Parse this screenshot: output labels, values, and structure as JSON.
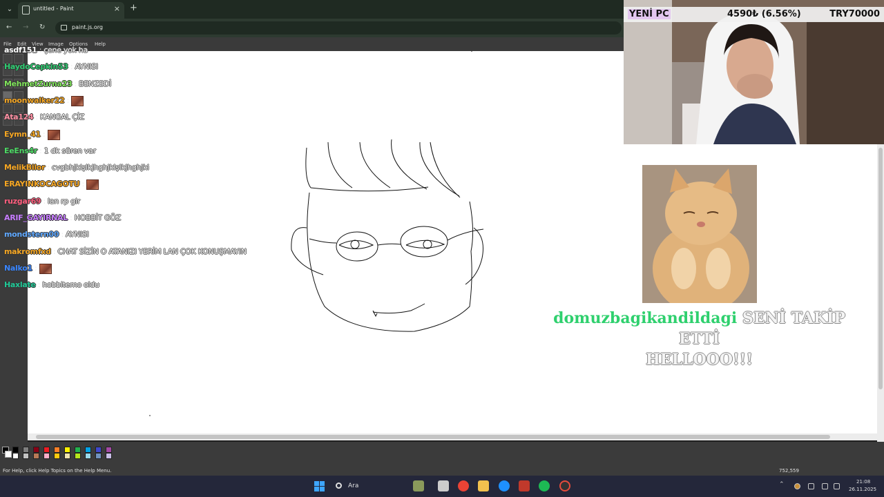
{
  "browser": {
    "tab_title": "untitled - Paint",
    "url": "paint.js.org",
    "close_glyph": "×",
    "new_tab_glyph": "+",
    "back_glyph": "←",
    "forward_glyph": "→",
    "reload_glyph": "↻",
    "tab_menu_glyph": "⌄"
  },
  "paint": {
    "menu": [
      "File",
      "Edit",
      "View",
      "Image",
      "Options",
      "Help"
    ],
    "status_text": "For Help, click Help Topics on the Help Menu.",
    "cursor_coords": "752,559",
    "palette_colors": [
      "#000000",
      "#7f7f7f",
      "#880015",
      "#ed1c24",
      "#ff7f27",
      "#fff200",
      "#22b14c",
      "#00a2e8",
      "#3f48cc",
      "#a349a4",
      "#ffffff",
      "#c3c3c3",
      "#b97a57",
      "#ffaec9",
      "#ffc90e",
      "#efe4b0",
      "#b5e61d",
      "#99d9ea",
      "#7092be",
      "#c8bfe7"
    ]
  },
  "chat": {
    "separator": " : ",
    "messages": [
      {
        "user": "asdf151",
        "color": "#ffffff",
        "text": "çene yok ha",
        "emote": false
      },
      {
        "user": "HaydoCepkin53",
        "color": "#2ecc71",
        "text": "AYNISI",
        "emote": false
      },
      {
        "user": "MehmetZurna23",
        "color": "#7fe35a",
        "text": "BENZEDİ",
        "emote": false
      },
      {
        "user": "moonwalker22",
        "color": "#f5a623",
        "text": "",
        "emote": true
      },
      {
        "user": "Ata124",
        "color": "#ff8fa3",
        "text": "KANGAL ÇİZ",
        "emote": false
      },
      {
        "user": "Eymn_41",
        "color": "#f5a623",
        "text": "",
        "emote": true
      },
      {
        "user": "EeEns4r",
        "color": "#4cd964",
        "text": "1 dk süren var",
        "emote": false
      },
      {
        "user": "MelikBilor",
        "color": "#f5a623",
        "text": "cvgbhjklşlkjhghjklşlkjhghjki",
        "emote": false
      },
      {
        "user": "ERAYINKOCAGOTU",
        "color": "#f5a623",
        "text": "",
        "emote": true
      },
      {
        "user": "ruzgar69",
        "color": "#ff5e7e",
        "text": "lan rp gir",
        "emote": false
      },
      {
        "user": "ARIF_GAYIRNAL",
        "color": "#c77dff",
        "text": "HOBBİT GÖZ",
        "emote": false
      },
      {
        "user": "mondstern00",
        "color": "#5fa8ff",
        "text": "AYNISI",
        "emote": false
      },
      {
        "user": "makromfxd",
        "color": "#f5a623",
        "text": "CHAT SİZİN O ATANIZI YERİM LAN ÇOK KONUŞMAYIN",
        "emote": false
      },
      {
        "user": "Nalko1",
        "color": "#3a86ff",
        "text": "",
        "emote": true
      },
      {
        "user": "Haxlate",
        "color": "#20c997",
        "text": "hobbitemo oldu",
        "emote": false
      }
    ]
  },
  "donation_bar": {
    "label": "YENİ PC",
    "amount": "4590₺ (6.56%)",
    "goal": "TRY70000"
  },
  "follow_alert": {
    "username": "domuzbagikandildagi",
    "message_line1": "SENİ TAKİP ETTİ",
    "message_line2": "HELLOOO!!!"
  },
  "taskbar": {
    "search_label": "Ara",
    "time": "21:08",
    "date": "26.11.2025"
  }
}
